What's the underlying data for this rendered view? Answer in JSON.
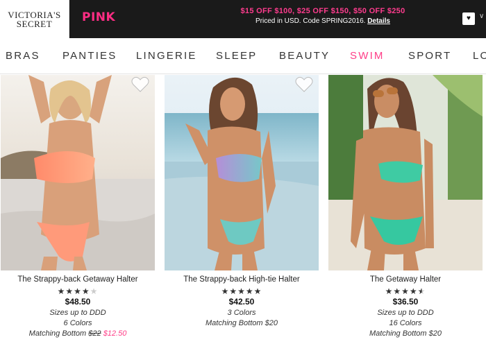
{
  "header": {
    "logo_line1": "VICTORIA'S",
    "logo_line2": "SECRET",
    "pink_label": "PINK",
    "promo_line1": "$15 OFF $100, $25 OFF $150, $50 OFF $250",
    "promo_line2": "Priced in USD. Code SPRING2016.",
    "promo_details": "Details",
    "bag_icon": "shopping-bag-icon"
  },
  "nav": {
    "items": [
      {
        "label": "BRAS"
      },
      {
        "label": "PANTIES"
      },
      {
        "label": "LINGERIE"
      },
      {
        "label": "SLEEP"
      },
      {
        "label": "BEAUTY"
      },
      {
        "label": "SWIM"
      },
      {
        "label": "SPORT"
      },
      {
        "label": "LO"
      }
    ],
    "active": "SWIM",
    "active_color": "#ff3d87"
  },
  "products": [
    {
      "name": "The Strappy-back Getaway Halter",
      "rating": 4,
      "price": "$48.50",
      "sizes": "Sizes up to DDD",
      "colors": "6 Colors",
      "matching_label": "Matching Bottom",
      "matching_old": "$22",
      "matching_sale": "$12.50"
    },
    {
      "name": "The Strappy-back High-tie Halter",
      "rating": 5,
      "price": "$42.50",
      "colors": "3 Colors",
      "matching_text": "Matching Bottom $20"
    },
    {
      "name": "The Getaway Halter",
      "rating": 4.5,
      "price": "$36.50",
      "sizes": "Sizes up to DDD",
      "colors": "16 Colors",
      "matching_text": "Matching Bottom $20"
    }
  ],
  "colors": {
    "topbar_bg": "#1a1a1a",
    "brand_pink": "#ff3d87"
  }
}
